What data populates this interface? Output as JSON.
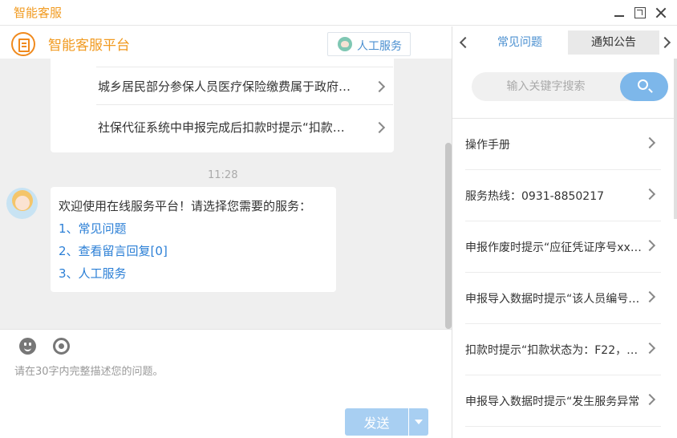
{
  "window": {
    "title": "智能客服"
  },
  "header": {
    "platform_title": "智能客服平台",
    "human_service_label": "人工服务"
  },
  "faq_list": [
    "城乡居民部分参保人员医疗保险缴费属于政府…",
    "社保代征系统中申报完成后扣款时提示“扣款…"
  ],
  "chat": {
    "time": "11:28",
    "message": "欢迎使用在线服务平台！请选择您需要的服务：",
    "options": [
      "1、常见问题",
      "2、查看留言回复[0]",
      "3、人工服务"
    ]
  },
  "composer": {
    "placeholder": "请在30字内完整描述您的问题。",
    "send_label": "发送"
  },
  "right_panel": {
    "tabs": [
      "常见问题",
      "通知公告"
    ],
    "active_tab": "通知公告",
    "search_placeholder": "输入关键字搜索",
    "items": [
      "操作手册",
      "服务热线：0931-8850217",
      "申报作废时提示“应征凭证序号xxx…",
      "申报导入数据时提示“该人员编号…",
      "扣款时提示“扣款状态为：F22，…",
      "申报导入数据时提示“发生服务异常"
    ]
  },
  "icons": {
    "logo": "service-logo-icon",
    "human_service": "agent-avatar-icon",
    "emoji": "emoji-icon",
    "agent": "agent-headset-icon",
    "search": "search-icon"
  },
  "colors": {
    "brand_orange": "#f19a1f",
    "link_blue": "#2b7fd6",
    "send_button": "#a8cff2",
    "search_button": "#7db7ea"
  }
}
